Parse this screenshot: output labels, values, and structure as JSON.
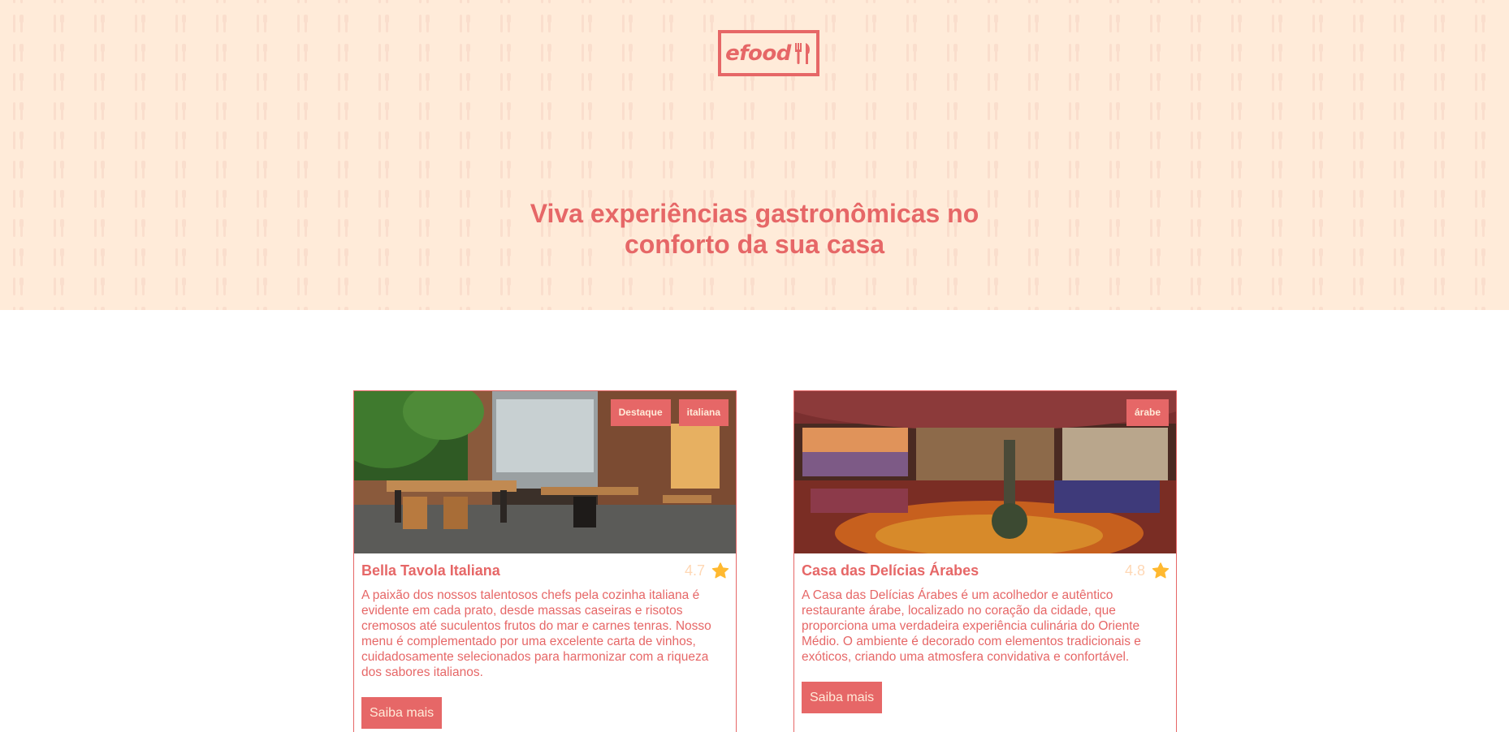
{
  "brand": {
    "logo_text": "efood"
  },
  "hero": {
    "headline": "Viva experiências gastronômicas no conforto da sua casa"
  },
  "colors": {
    "primary": "#E66767",
    "cream": "#FFEBD9",
    "rating": "#FFD8B5",
    "star": "#FFB930"
  },
  "restaurants": [
    {
      "name": "Bella Tavola Italiana",
      "rating": "4.7",
      "tags": [
        "Destaque",
        "italiana"
      ],
      "description": "A paixão dos nossos talentosos chefs pela cozinha italiana é evidente em cada prato, desde massas caseiras e risotos cremosos até suculentos frutos do mar e carnes tenras. Nosso menu é complementado por uma excelente carta de vinhos, cuidadosamente selecionados para harmonizar com a riqueza dos sabores italianos.",
      "button": "Saiba mais",
      "icon": "star-icon"
    },
    {
      "name": "Casa das Delícias Árabes",
      "rating": "4.8",
      "tags": [
        "árabe"
      ],
      "description": "A Casa das Delícias Árabes é um acolhedor e autêntico restaurante árabe, localizado no coração da cidade, que proporciona uma verdadeira experiência culinária do Oriente Médio. O ambiente é decorado com elementos tradicionais e exóticos, criando uma atmosfera convidativa e confortável.",
      "button": "Saiba mais",
      "icon": "star-icon"
    }
  ]
}
